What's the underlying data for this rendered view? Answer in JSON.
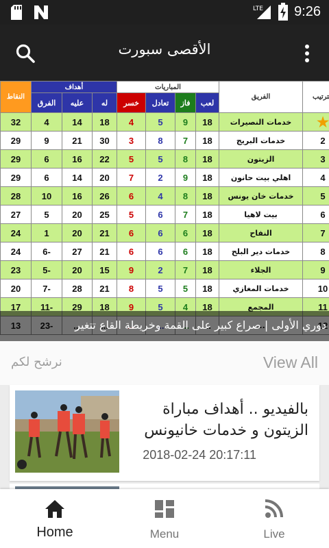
{
  "status": {
    "time": "9:26",
    "network": "LTE"
  },
  "appbar": {
    "title": "الأقصى سبورت"
  },
  "standings": {
    "headers": {
      "points": "النقاط",
      "goals_group": "أهداف",
      "diff": "الفرق",
      "against": "عليه",
      "for": "له",
      "matches_group": "المباريات",
      "lost": "خسر",
      "draw": "تعادل",
      "won": "فاز",
      "played": "لعب",
      "team": "الفريق",
      "rank": "الترتيب"
    },
    "rows": [
      {
        "pts": "32",
        "diff": "4",
        "ga": "14",
        "gf": "18",
        "l": "4",
        "d": "5",
        "w": "9",
        "p": "18",
        "team": "خدمات النصيرات",
        "rank": "★"
      },
      {
        "pts": "29",
        "diff": "9",
        "ga": "21",
        "gf": "30",
        "l": "3",
        "d": "8",
        "w": "7",
        "p": "18",
        "team": "خدمات البريج",
        "rank": "2"
      },
      {
        "pts": "29",
        "diff": "6",
        "ga": "16",
        "gf": "22",
        "l": "5",
        "d": "5",
        "w": "8",
        "p": "18",
        "team": "الزيتون",
        "rank": "3"
      },
      {
        "pts": "29",
        "diff": "6",
        "ga": "14",
        "gf": "20",
        "l": "7",
        "d": "2",
        "w": "9",
        "p": "18",
        "team": "اهلي بيت حانون",
        "rank": "4"
      },
      {
        "pts": "28",
        "diff": "10",
        "ga": "16",
        "gf": "26",
        "l": "6",
        "d": "4",
        "w": "8",
        "p": "18",
        "team": "خدمات خان يونس",
        "rank": "5"
      },
      {
        "pts": "27",
        "diff": "5",
        "ga": "20",
        "gf": "25",
        "l": "5",
        "d": "6",
        "w": "7",
        "p": "18",
        "team": "بيت لاهيا",
        "rank": "6"
      },
      {
        "pts": "24",
        "diff": "1",
        "ga": "20",
        "gf": "21",
        "l": "6",
        "d": "6",
        "w": "6",
        "p": "18",
        "team": "النفاح",
        "rank": "7"
      },
      {
        "pts": "24",
        "diff": "6-",
        "ga": "27",
        "gf": "21",
        "l": "6",
        "d": "6",
        "w": "6",
        "p": "18",
        "team": "خدمات دير البلح",
        "rank": "8"
      },
      {
        "pts": "23",
        "diff": "5-",
        "ga": "20",
        "gf": "15",
        "l": "9",
        "d": "2",
        "w": "7",
        "p": "18",
        "team": "الجلاء",
        "rank": "9"
      },
      {
        "pts": "20",
        "diff": "7-",
        "ga": "28",
        "gf": "21",
        "l": "8",
        "d": "5",
        "w": "5",
        "p": "18",
        "team": "خدمات المغازي",
        "rank": "10"
      },
      {
        "pts": "17",
        "diff": "11-",
        "ga": "29",
        "gf": "18",
        "l": "9",
        "d": "5",
        "w": "4",
        "p": "18",
        "team": "المجمع",
        "rank": "11"
      },
      {
        "pts": "13",
        "diff": "23-",
        "ga": "...",
        "gf": "...",
        "l": "...",
        "d": "...",
        "w": "...",
        "p": "...",
        "team": "...",
        "rank": "12"
      }
    ]
  },
  "featured_caption": "دوري الأولى | صراع كبير على القمة وخريطة القاع تتغير",
  "section": {
    "view_all": "View All",
    "recommend": "نرشح لكم"
  },
  "article": {
    "title": "بالفيديو .. أهداف مباراة الزيتون و خدمات خانيونس",
    "date": "2018-02-24 20:17:11"
  },
  "nav": {
    "home": "Home",
    "menu": "Menu",
    "live": "Live"
  },
  "colors": {
    "appbar": "#212121",
    "statusbar": "#1f1f1f",
    "points_col": "#ff9a1f",
    "goals_hdr": "#2e35a8",
    "lost": "#cc0000",
    "draw": "#2e35a8",
    "won": "#1d7d1d",
    "row_green": "#c8f08c",
    "active_nav": "#212121",
    "inactive_nav": "#757575"
  }
}
